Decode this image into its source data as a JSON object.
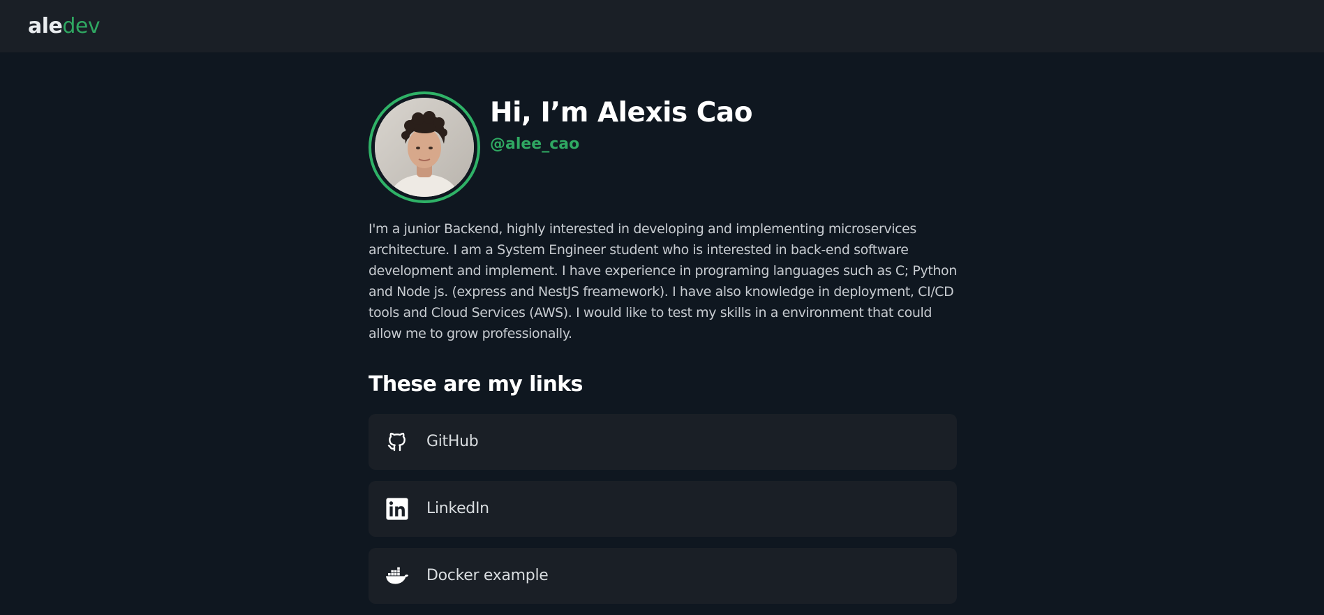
{
  "header": {
    "logo_part1": "ale",
    "logo_part2": "dev"
  },
  "profile": {
    "name": "Hi, I’m Alexis Cao",
    "handle": "@alee_cao",
    "bio": "I'm a junior Backend, highly interested in developing and implementing microservices architecture. I am a System Engineer student who is interested in back-end software development and implement. I have experience in programing languages such as C; Python and Node js. (express and NestJS freamework). I have also knowledge in deployment, CI/CD tools and Cloud Services (AWS). I would like to test my skills in a environment that could allow me to grow professionally."
  },
  "links_section": {
    "title": "These are my links",
    "items": [
      {
        "label": "GitHub",
        "icon": "github-icon"
      },
      {
        "label": "LinkedIn",
        "icon": "linkedin-icon"
      },
      {
        "label": "Docker example",
        "icon": "docker-icon"
      }
    ]
  },
  "colors": {
    "background": "#0f1720",
    "header_background": "#1a1f26",
    "card_background": "#1a1f26",
    "accent": "#2fa862",
    "avatar_ring": "#2fb267"
  }
}
